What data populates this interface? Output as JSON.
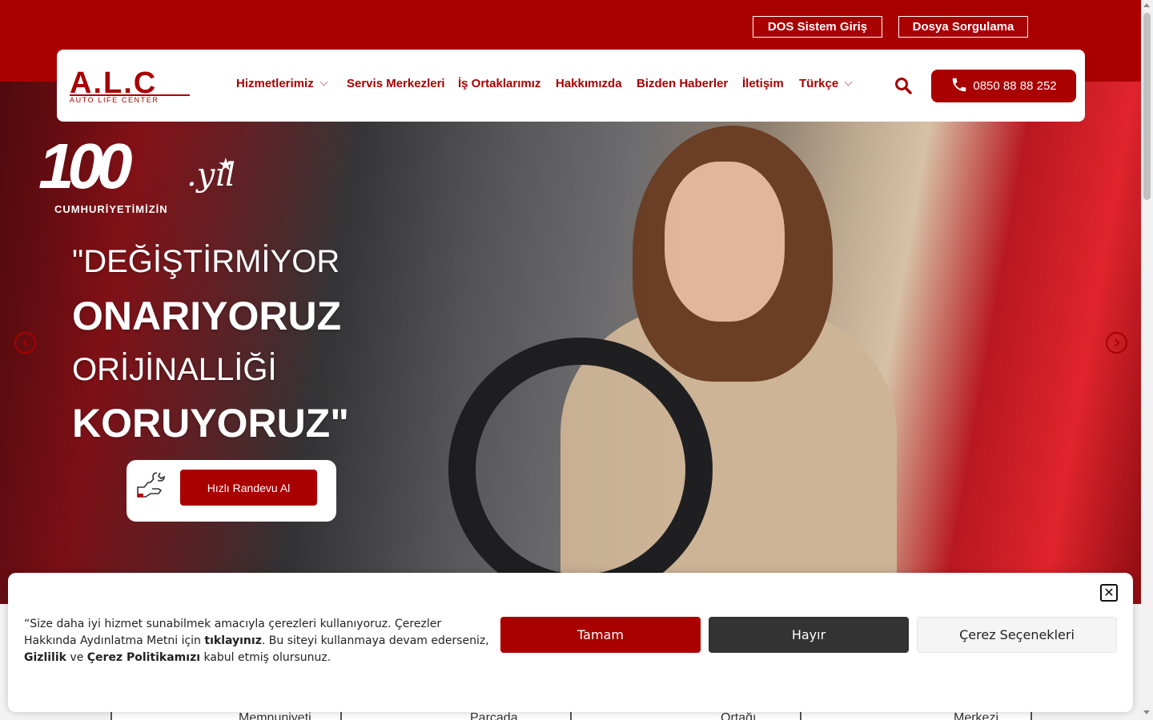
{
  "topbar": {
    "dos_label": "DOS Sistem Giriş",
    "dosya_label": "Dosya Sorgulama"
  },
  "header": {
    "logo_text": "A.L.C",
    "logo_sub": "AUTO LIFE CENTER",
    "nav": [
      {
        "label": "Hizmetlerimiz",
        "dropdown": true
      },
      {
        "label": "Servis Merkezleri",
        "dropdown": false
      },
      {
        "label": "İş Ortaklarımız",
        "dropdown": false
      },
      {
        "label": "Hakkımızda",
        "dropdown": false
      },
      {
        "label": "Bizden Haberler",
        "dropdown": false
      },
      {
        "label": "İletişim",
        "dropdown": false
      },
      {
        "label": "Türkçe",
        "dropdown": true
      }
    ],
    "search_icon": "search-icon",
    "phone": "0850 88 88 252"
  },
  "hero": {
    "badge_number": "100",
    "badge_yil": ".yıl",
    "badge_sub": "CUMHURİYETİMİZİN",
    "slogan": [
      "\"DEĞİŞTİRMİYOR",
      "ONARIYORUZ",
      "ORİJİNALLİĞİ",
      "KORUYORUZ\""
    ],
    "cta_label": "Hızlı Randevu Al"
  },
  "cards": [
    {
      "label": "Memnuniyeti"
    },
    {
      "label": "Parçada"
    },
    {
      "label": "Ortağı"
    },
    {
      "label": "Merkezi"
    }
  ],
  "cookie": {
    "text_1": "“Size daha iyi hizmet sunabilmek amacıyla çerezleri kullanıyoruz. Çerezler Hakkında Aydınlatma Metni için ",
    "link_1": "tıklayınız",
    "text_2": ". Bu siteyi kullanmaya devam ederseniz, ",
    "link_2": "Gizlilik",
    "text_3": " ve ",
    "link_3": "Çerez Politikamızı",
    "text_4": " kabul etmiş olursunuz.",
    "ok_label": "Tamam",
    "no_label": "Hayır",
    "options_label": "Çerez Seçenekleri"
  },
  "colors": {
    "brand": "#a90000",
    "dark_button": "#333333"
  }
}
